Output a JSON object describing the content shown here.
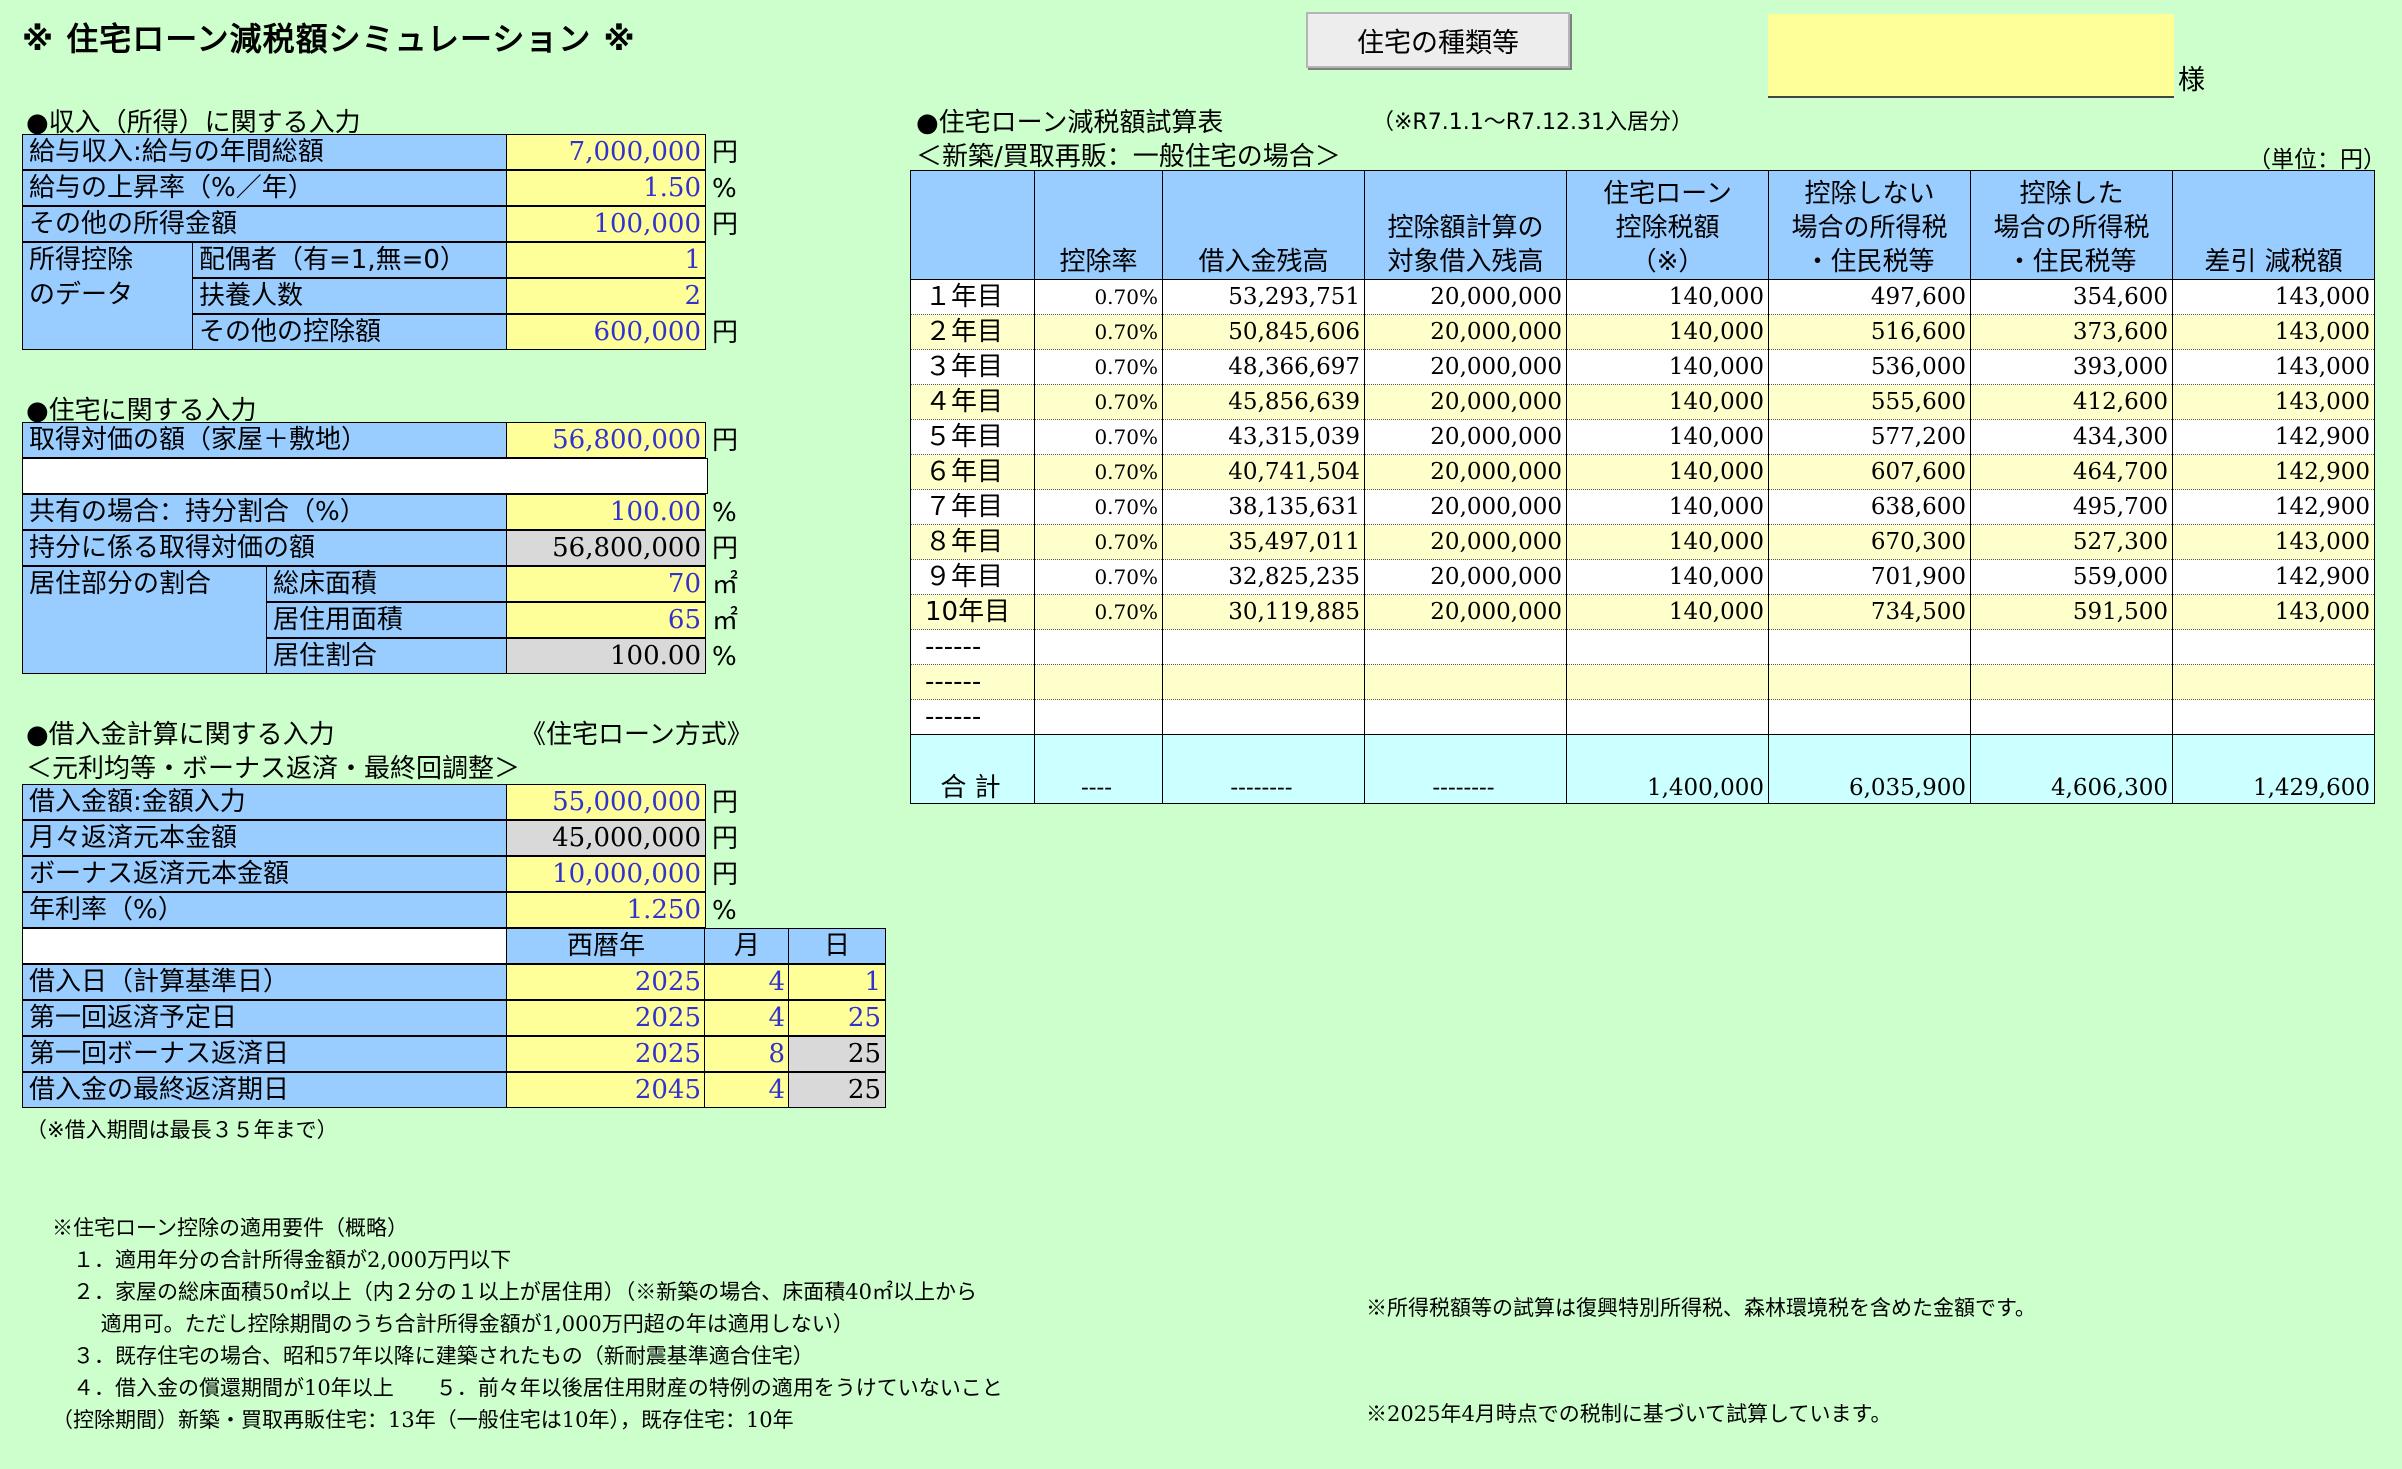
{
  "title": "※ 住宅ローン減税額シミュレーション ※",
  "house_type_button": "住宅の種類等",
  "customer": {
    "name": "",
    "suffix": "様"
  },
  "income": {
    "heading": "●収入（所得）に関する入力",
    "rows": [
      {
        "label": "給与収入:給与の年間総額",
        "value": "7,000,000",
        "unit": "円"
      },
      {
        "label": "給与の上昇率（%／年）",
        "value": "1.50",
        "unit": "%"
      },
      {
        "label": "その他の所得金額",
        "value": "100,000",
        "unit": "円"
      }
    ],
    "deduction_group_label": "所得控除\nのデータ",
    "deduction_rows": [
      {
        "label": "配偶者（有=1,無=0）",
        "value": "1",
        "unit": ""
      },
      {
        "label": "扶養人数",
        "value": "2",
        "unit": ""
      },
      {
        "label": "その他の控除額",
        "value": "600,000",
        "unit": "円"
      }
    ]
  },
  "housing": {
    "heading": "●住宅に関する入力",
    "acquisition": {
      "label": "取得対価の額（家屋＋敷地）",
      "value": "56,800,000",
      "unit": "円"
    },
    "share": {
      "label": "共有の場合：持分割合（%）",
      "value": "100.00",
      "unit": "%"
    },
    "share_amount": {
      "label": "持分に係る取得対価の額",
      "value": "56,800,000",
      "unit": "円"
    },
    "residence_group_label": "居住部分の割合",
    "residence_rows": [
      {
        "label": "総床面積",
        "value": "70",
        "unit": "㎡"
      },
      {
        "label": "居住用面積",
        "value": "65",
        "unit": "㎡"
      },
      {
        "label": "居住割合",
        "value": "100.00",
        "unit": "%"
      }
    ]
  },
  "loan": {
    "heading": "●借入金計算に関する入力",
    "method": "《住宅ローン方式》",
    "subheading": "＜元利均等・ボーナス返済・最終回調整＞",
    "rows": [
      {
        "label": "借入金額:金額入力",
        "value": "55,000,000",
        "unit": "円"
      },
      {
        "label": "月々返済元本金額",
        "value": "45,000,000",
        "unit": "円"
      },
      {
        "label": "ボーナス返済元本金額",
        "value": "10,000,000",
        "unit": "円"
      },
      {
        "label": "年利率（%）",
        "value": "1.250",
        "unit": "%"
      }
    ],
    "date_headers": {
      "year": "西暦年",
      "month": "月",
      "day": "日"
    },
    "dates": [
      {
        "label": "借入日（計算基準日）",
        "year": "2025",
        "month": "4",
        "day": "1"
      },
      {
        "label": "第一回返済予定日",
        "year": "2025",
        "month": "4",
        "day": "25"
      },
      {
        "label": "第一回ボーナス返済日",
        "year": "2025",
        "month": "8",
        "day": "25"
      },
      {
        "label": "借入金の最終返済期日",
        "year": "2045",
        "month": "4",
        "day": "25"
      }
    ],
    "note": "（※借入期間は最長３５年まで）"
  },
  "results": {
    "heading": "●住宅ローン減税額試算表",
    "period": "（※R7.1.1～R7.12.31入居分）",
    "subheading": "＜新築/買取再販：一般住宅の場合＞",
    "unit": "（単位：円）",
    "headers": [
      "",
      "控除率",
      "借入金残高",
      "控除額計算の\n対象借入残高",
      "住宅ローン\n控除税額\n（※）",
      "控除しない\n場合の所得税\n・住民税等",
      "控除した\n場合の所得税\n・住民税等",
      "差引 減税額"
    ],
    "rows": [
      [
        "１年目",
        "0.70%",
        "53,293,751",
        "20,000,000",
        "140,000",
        "497,600",
        "354,600",
        "143,000"
      ],
      [
        "２年目",
        "0.70%",
        "50,845,606",
        "20,000,000",
        "140,000",
        "516,600",
        "373,600",
        "143,000"
      ],
      [
        "３年目",
        "0.70%",
        "48,366,697",
        "20,000,000",
        "140,000",
        "536,000",
        "393,000",
        "143,000"
      ],
      [
        "４年目",
        "0.70%",
        "45,856,639",
        "20,000,000",
        "140,000",
        "555,600",
        "412,600",
        "143,000"
      ],
      [
        "５年目",
        "0.70%",
        "43,315,039",
        "20,000,000",
        "140,000",
        "577,200",
        "434,300",
        "142,900"
      ],
      [
        "６年目",
        "0.70%",
        "40,741,504",
        "20,000,000",
        "140,000",
        "607,600",
        "464,700",
        "142,900"
      ],
      [
        "７年目",
        "0.70%",
        "38,135,631",
        "20,000,000",
        "140,000",
        "638,600",
        "495,700",
        "142,900"
      ],
      [
        "８年目",
        "0.70%",
        "35,497,011",
        "20,000,000",
        "140,000",
        "670,300",
        "527,300",
        "143,000"
      ],
      [
        "９年目",
        "0.70%",
        "32,825,235",
        "20,000,000",
        "140,000",
        "701,900",
        "559,000",
        "142,900"
      ],
      [
        "10年目",
        "0.70%",
        "30,119,885",
        "20,000,000",
        "140,000",
        "734,500",
        "591,500",
        "143,000"
      ],
      [
        "------",
        "",
        "",
        "",
        "",
        "",
        "",
        ""
      ],
      [
        "------",
        "",
        "",
        "",
        "",
        "",
        "",
        ""
      ],
      [
        "------",
        "",
        "",
        "",
        "",
        "",
        "",
        ""
      ]
    ],
    "total": [
      "合 計",
      "----",
      "--------",
      "--------",
      "1,400,000",
      "6,035,900",
      "4,606,300",
      "1,429,600"
    ]
  },
  "requirements": {
    "lines": [
      "※住宅ローン控除の適用要件（概略）",
      "　１．適用年分の合計所得金額が2,000万円以下",
      "　２．家屋の総床面積50㎡以上（内２分の１以上が居住用）（※新築の場合、床面積40㎡以上から",
      "　　 適用可。ただし控除期間のうち合計所得金額が1,000万円超の年は適用しない）",
      "　３．既存住宅の場合、昭和57年以降に建築されたもの（新耐震基準適合住宅）",
      "　４．借入金の償還期間が10年以上　　５．前々年以後居住用財産の特例の適用をうけていないこと",
      "（控除期間）新築・買取再販住宅：13年（一般住宅は10年），既存住宅：10年"
    ]
  },
  "notes_right": [
    "※所得税額等の試算は復興特別所得税、森林環境税を含めた金額です。",
    "※2025年4月時点での税制に基づいて試算しています。"
  ]
}
